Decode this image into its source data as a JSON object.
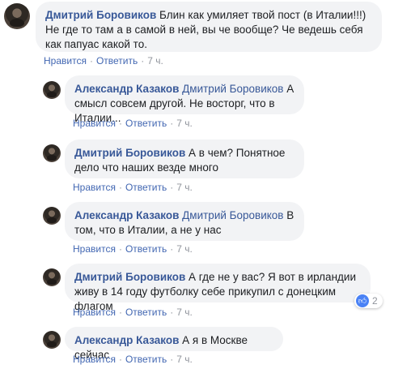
{
  "comments": [
    {
      "author": "Дмитрий Боровиков",
      "mention": "",
      "text": "Блин как умиляет твой пост (в Италии!!!) Не где то там а в самой в ней, вы че вообще? Че ведешь себя как папуас какой то.",
      "like": "Нравится",
      "reply": "Ответить",
      "time": "7 ч."
    },
    {
      "author": "Александр Казаков",
      "mention": "Дмитрий Боровиков",
      "text": "А смысл совсем другой. Не восторг, что в Италии...",
      "like": "Нравится",
      "reply": "Ответить",
      "time": "7 ч."
    },
    {
      "author": "Дмитрий Боровиков",
      "mention": "",
      "text": "А в чем? Понятное дело что наших везде много",
      "like": "Нравится",
      "reply": "Ответить",
      "time": "7 ч."
    },
    {
      "author": "Александр Казаков",
      "mention": "Дмитрий Боровиков",
      "text": "В том, что в Италии, а не у нас",
      "like": "Нравится",
      "reply": "Ответить",
      "time": "7 ч."
    },
    {
      "author": "Дмитрий Боровиков",
      "mention": "",
      "text": "А где не у вас? Я вот в ирландии живу в 14 году футболку себе прикупил с донецким флагом",
      "like": "Нравится",
      "reply": "Ответить",
      "time": "7 ч.",
      "reaction_count": "2"
    },
    {
      "author": "Александр Казаков",
      "mention": "",
      "text": "А я в Москве сейчас",
      "like": "Нравится",
      "reply": "Ответить",
      "time": "7 ч."
    }
  ],
  "separator": "·",
  "icons": {
    "avatar": "user-avatar",
    "reaction": "like-icon"
  },
  "colors": {
    "link": "#385898",
    "bubble": "#f2f3f5",
    "meta": "#90949c",
    "action": "#4267b2"
  }
}
